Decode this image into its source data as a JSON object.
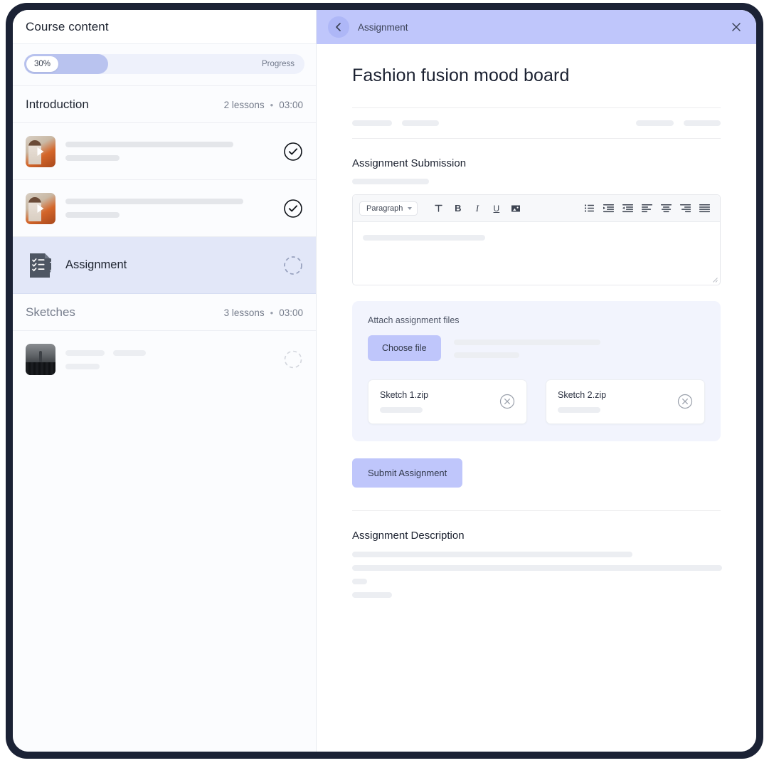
{
  "sidebar": {
    "title": "Course content",
    "progress": {
      "value_label": "30%",
      "label": "Progress",
      "percent": 30
    },
    "sections": [
      {
        "name": "Introduction",
        "lessons_label": "2 lessons",
        "separator": "•",
        "duration": "03:00"
      },
      {
        "name": "Sketches",
        "lessons_label": "3 lessons",
        "separator": "•",
        "duration": "03:00"
      }
    ],
    "lessons": [
      {
        "label": "",
        "status": "completed",
        "thumb": "person-video-thumbnail"
      },
      {
        "label": "",
        "status": "completed",
        "thumb": "person-video-thumbnail"
      },
      {
        "label": "Assignment",
        "status": "pending",
        "thumb": "assignment-checklist-icon"
      },
      {
        "label": "",
        "status": "pending",
        "thumb": "city-video-thumbnail"
      }
    ]
  },
  "panel": {
    "header": {
      "title": "Assignment",
      "back_icon": "chevron-left-icon",
      "close_icon": "close-icon"
    },
    "doc_title": "Fashion fusion mood board",
    "submission": {
      "heading": "Assignment Submission",
      "toolbar": {
        "style_select": "Paragraph",
        "buttons": [
          "text-color-icon",
          "bold-icon",
          "italic-icon",
          "underline-icon",
          "image-icon",
          "bullet-list-icon",
          "indent-icon",
          "outdent-icon",
          "align-left-icon",
          "align-center-icon",
          "align-right-icon",
          "align-justify-icon"
        ]
      },
      "editor_value": "",
      "editor_placeholder": ""
    },
    "attach": {
      "title": "Attach assignment files",
      "choose_file_label": "Choose file",
      "files": [
        {
          "name": "Sketch 1.zip",
          "remove_icon": "remove-circle-icon"
        },
        {
          "name": "Sketch 2.zip",
          "remove_icon": "remove-circle-icon"
        }
      ]
    },
    "submit_label": "Submit Assignment",
    "description": {
      "heading": "Assignment Description"
    }
  },
  "colors": {
    "accent_lavender": "#bfc6fb",
    "active_row": "#e2e7f8",
    "progress_fill": "#b9c3ef",
    "frame": "#1b2235"
  }
}
